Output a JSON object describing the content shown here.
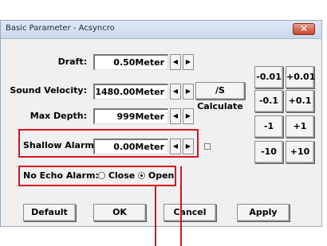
{
  "window": {
    "title": "Basic Parameter - Acsyncro",
    "close_glyph": "✕"
  },
  "params": {
    "draft": {
      "label": "Draft:",
      "value": "0.50Meter"
    },
    "sound_velocity": {
      "label": "Sound Velocity:",
      "value": "1480.00Meter",
      "calc_label": "/S Calculate"
    },
    "max_depth": {
      "label": "Max Depth:",
      "value": "999Meter"
    },
    "shallow_alarm": {
      "label": "Shallow Alarm:",
      "value": "0.00Meter"
    }
  },
  "spin": {
    "left": "◀",
    "right": "▶"
  },
  "steps": {
    "minus_001": "-0.01",
    "plus_001": "+0.01",
    "minus_01": "-0.1",
    "plus_01": "+0.1",
    "minus_1": "-1",
    "plus_1": "+1",
    "minus_10": "-10",
    "plus_10": "+10"
  },
  "no_echo": {
    "label": "No Echo Alarm:",
    "close": "Close",
    "open": "Open",
    "selected": "Open"
  },
  "buttons": {
    "default": "Default",
    "ok": "OK",
    "cancel": "Cancel",
    "apply": "Apply"
  },
  "highlight_color": "#d8121b"
}
